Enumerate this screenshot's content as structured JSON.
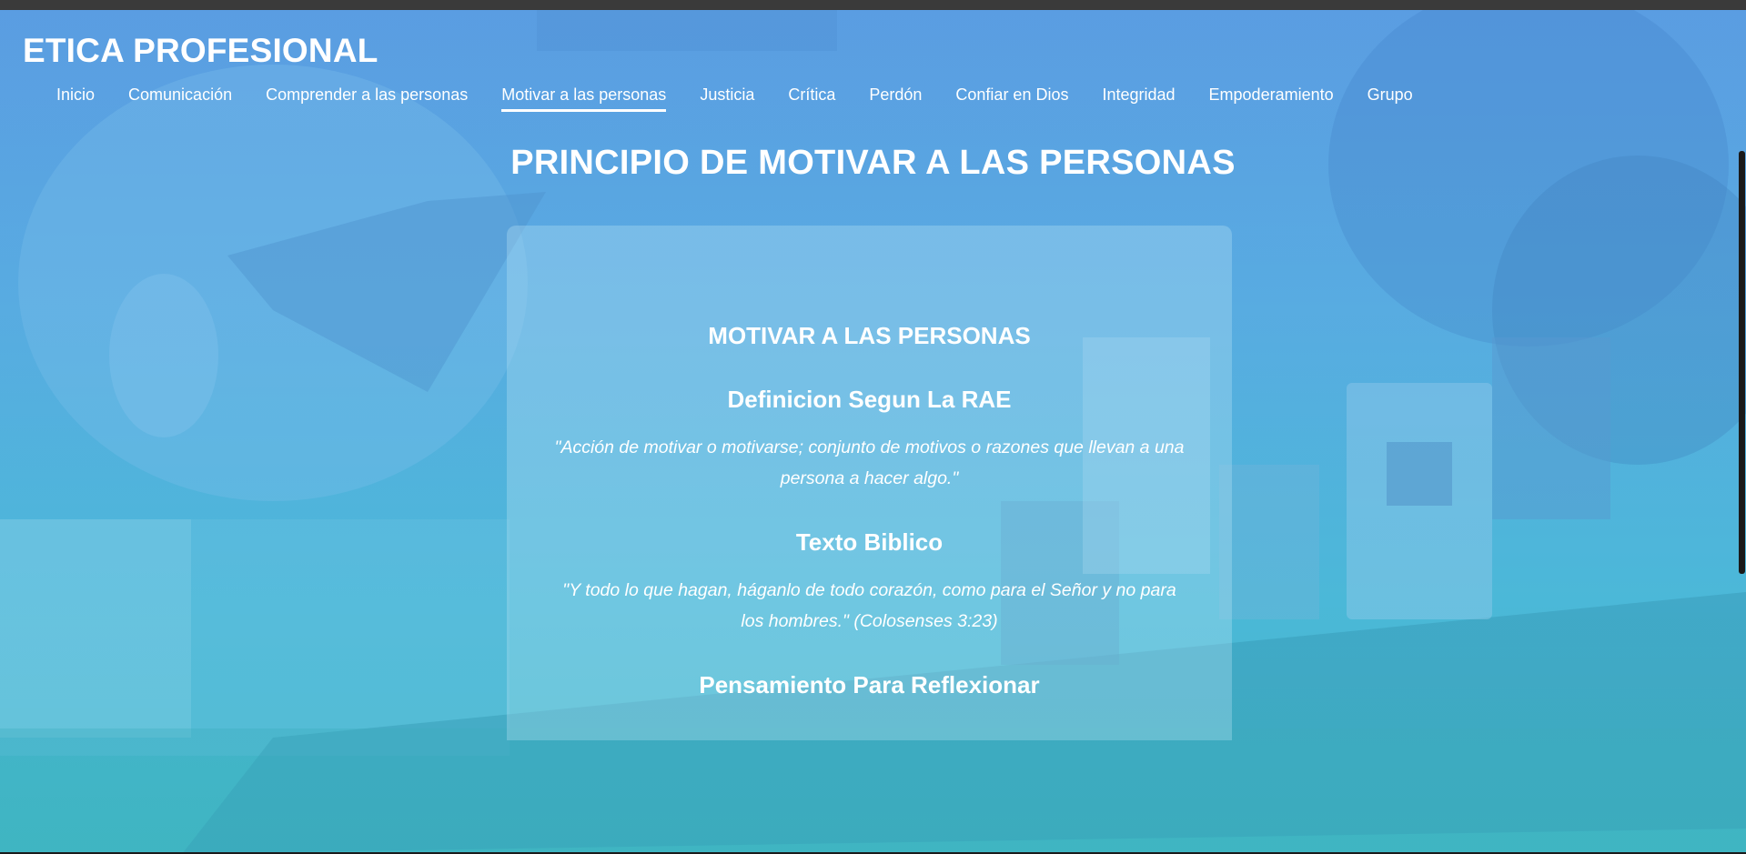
{
  "site": {
    "brand": "ETICA PROFESIONAL"
  },
  "nav": {
    "items": [
      {
        "label": "Inicio",
        "active": false
      },
      {
        "label": "Comunicación",
        "active": false
      },
      {
        "label": "Comprender a las personas",
        "active": false
      },
      {
        "label": "Motivar a las personas",
        "active": true
      },
      {
        "label": "Justicia",
        "active": false
      },
      {
        "label": "Crítica",
        "active": false
      },
      {
        "label": "Perdón",
        "active": false
      },
      {
        "label": "Confiar en Dios",
        "active": false
      },
      {
        "label": "Integridad",
        "active": false
      },
      {
        "label": "Empoderamiento",
        "active": false
      },
      {
        "label": "Grupo",
        "active": false
      }
    ]
  },
  "main": {
    "page_title": "PRINCIPIO DE MOTIVAR A LAS PERSONAS",
    "card": {
      "heading": "MOTIVAR A LAS PERSONAS",
      "section1_title": "Definicion Segun La RAE",
      "section1_text": "\"Acción de motivar o motivarse; conjunto de motivos o razones que llevan a una persona a hacer algo.\"",
      "section2_title": "Texto Biblico",
      "section2_text": "\"Y todo lo que hagan, háganlo de todo corazón, como para el Señor y no para los hombres.\" (Colosenses 3:23)",
      "section3_title": "Pensamiento Para Reflexionar"
    }
  },
  "colors": {
    "overlay_top": "#5a9fe0",
    "overlay_bottom": "#3fb7bf",
    "text": "#ffffff"
  }
}
